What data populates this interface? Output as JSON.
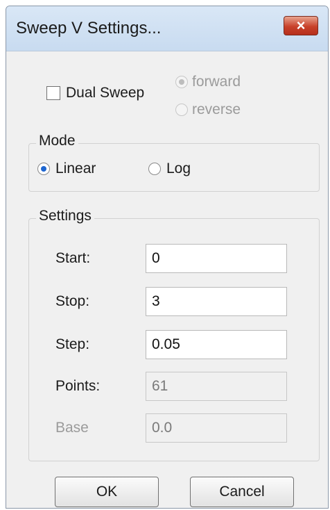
{
  "window": {
    "title": "Sweep V Settings...",
    "close_label": "×"
  },
  "dual_sweep": {
    "label": "Dual Sweep",
    "checked": false
  },
  "direction": {
    "forward_label": "forward",
    "reverse_label": "reverse",
    "selected": "forward",
    "enabled": false
  },
  "mode": {
    "title": "Mode",
    "linear_label": "Linear",
    "log_label": "Log",
    "selected": "Linear"
  },
  "settings": {
    "title": "Settings",
    "start": {
      "label": "Start:",
      "value": "0"
    },
    "stop": {
      "label": "Stop:",
      "value": "3"
    },
    "step": {
      "label": "Step:",
      "value": "0.05"
    },
    "points": {
      "label": "Points:",
      "value": "61"
    },
    "base": {
      "label": "Base",
      "value": "0.0"
    }
  },
  "buttons": {
    "ok": "OK",
    "cancel": "Cancel"
  },
  "colors": {
    "accent": "#1e66d0",
    "close": "#c8412a"
  }
}
